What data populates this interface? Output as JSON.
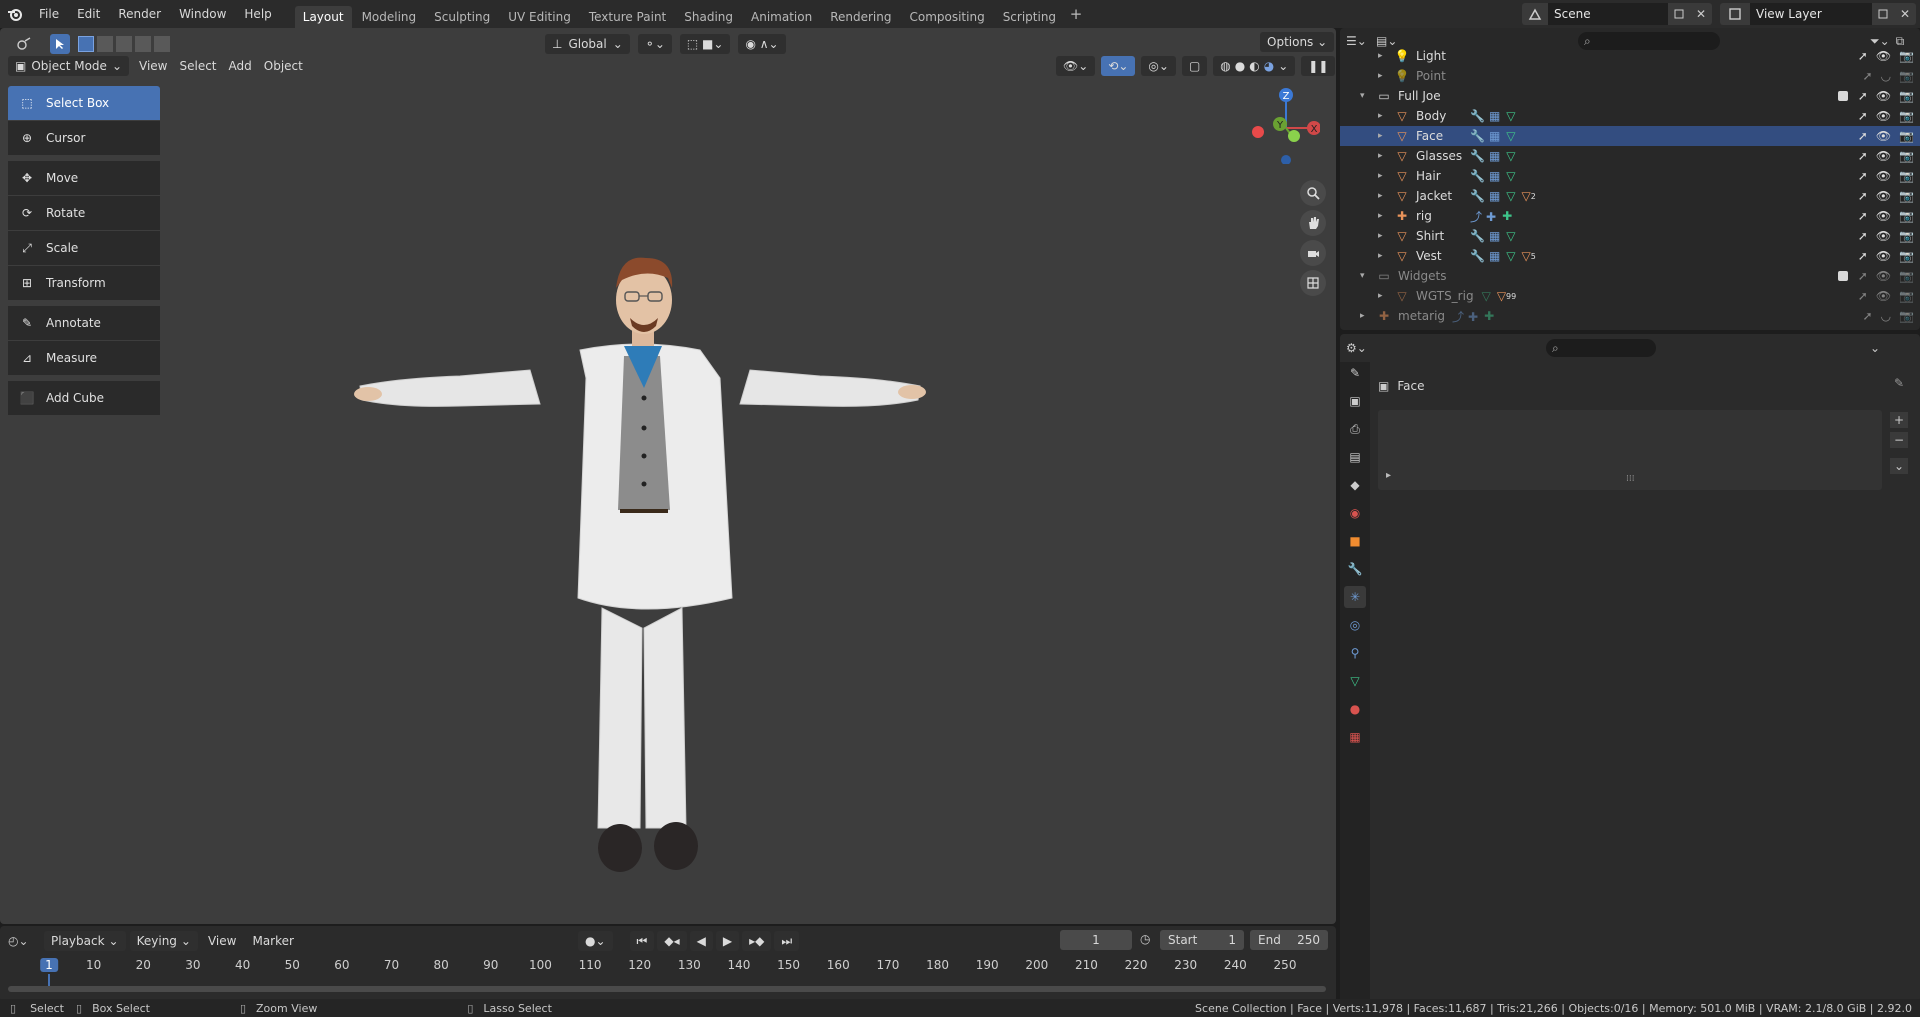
{
  "topbar": {
    "menus": [
      "File",
      "Edit",
      "Render",
      "Window",
      "Help"
    ],
    "workspaces": [
      "Layout",
      "Modeling",
      "Sculpting",
      "UV Editing",
      "Texture Paint",
      "Shading",
      "Animation",
      "Rendering",
      "Compositing",
      "Scripting"
    ],
    "active_workspace": "Layout",
    "scene_name": "Scene",
    "view_layer": "View Layer"
  },
  "viewport_header": {
    "mode": "Object Mode",
    "menus": [
      "View",
      "Select",
      "Add",
      "Object"
    ],
    "orientation": "Global",
    "options_label": "Options"
  },
  "toolbar": {
    "tools": [
      {
        "label": "Select Box",
        "icon": "select-box-icon",
        "active": true
      },
      {
        "label": "Cursor",
        "icon": "cursor-icon"
      },
      {
        "label": "Move",
        "icon": "move-icon"
      },
      {
        "label": "Rotate",
        "icon": "rotate-icon"
      },
      {
        "label": "Scale",
        "icon": "scale-icon"
      },
      {
        "label": "Transform",
        "icon": "transform-icon"
      },
      {
        "label": "Annotate",
        "icon": "annotate-icon"
      },
      {
        "label": "Measure",
        "icon": "measure-icon"
      },
      {
        "label": "Add Cube",
        "icon": "add-cube-icon"
      }
    ]
  },
  "outliner": {
    "rows": [
      {
        "name": "Light",
        "type": "light",
        "level": 2,
        "dim": false
      },
      {
        "name": "Point",
        "type": "light",
        "level": 2,
        "dim": true
      },
      {
        "name": "Full Joe",
        "type": "collection",
        "level": 1,
        "dim": false
      },
      {
        "name": "Body",
        "type": "mesh",
        "level": 2,
        "dim": false
      },
      {
        "name": "Face",
        "type": "mesh",
        "level": 2,
        "dim": false,
        "selected": true
      },
      {
        "name": "Glasses",
        "type": "mesh",
        "level": 2,
        "dim": false
      },
      {
        "name": "Hair",
        "type": "mesh",
        "level": 2,
        "dim": false
      },
      {
        "name": "Jacket",
        "type": "mesh",
        "level": 2,
        "dim": false,
        "badge": "2"
      },
      {
        "name": "rig",
        "type": "armature",
        "level": 2,
        "dim": false
      },
      {
        "name": "Shirt",
        "type": "mesh",
        "level": 2,
        "dim": false
      },
      {
        "name": "Vest",
        "type": "mesh",
        "level": 2,
        "dim": false,
        "badge": "5"
      },
      {
        "name": "Widgets",
        "type": "collection",
        "level": 1,
        "dim": true
      },
      {
        "name": "WGTS_rig",
        "type": "mesh",
        "level": 2,
        "dim": true,
        "badge": "99"
      },
      {
        "name": "metarig",
        "type": "armature",
        "level": 1,
        "dim": true
      }
    ]
  },
  "properties": {
    "object_name": "Face"
  },
  "timeline": {
    "menus": [
      "Playback",
      "Keying",
      "View",
      "Marker"
    ],
    "current_frame": "1",
    "start_label": "Start",
    "start_value": "1",
    "end_label": "End",
    "end_value": "250",
    "ticks": [
      "1",
      "10",
      "20",
      "30",
      "40",
      "50",
      "60",
      "70",
      "80",
      "90",
      "100",
      "110",
      "120",
      "130",
      "140",
      "150",
      "160",
      "170",
      "180",
      "190",
      "200",
      "210",
      "220",
      "230",
      "240",
      "250"
    ]
  },
  "statusbar": {
    "select": "Select",
    "box_select": "Box Select",
    "zoom_view": "Zoom View",
    "lasso_select": "Lasso Select",
    "stats": "Scene Collection | Face | Verts:11,978 | Faces:11,687 | Tris:21,266 | Objects:0/16 | Memory: 501.0 MiB | VRAM: 2.1/8.0 GiB | 2.92.0"
  },
  "colors": {
    "accent": "#4772b3",
    "selected_row": "#334d80",
    "mesh_icon": "#e8935a",
    "modifier_icon": "#6e9bd4",
    "data_icon": "#3ec48a"
  }
}
